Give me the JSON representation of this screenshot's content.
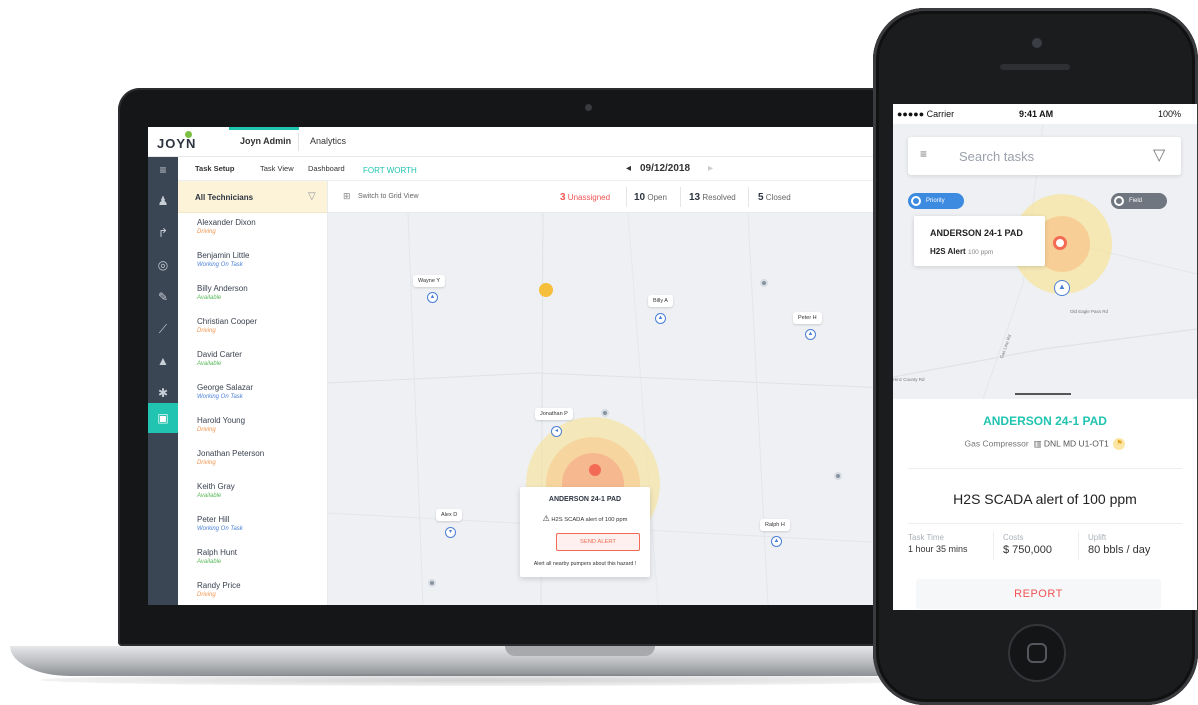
{
  "laptop": {
    "logo": "JOYN",
    "top_tabs": [
      {
        "label": "Joyn Admin",
        "active": true
      },
      {
        "label": "Analytics",
        "active": false
      }
    ],
    "sub_tabs": [
      {
        "label": "Task Setup",
        "active": true
      },
      {
        "label": "Task View",
        "active": false
      },
      {
        "label": "Dashboard",
        "active": false
      }
    ],
    "city": "FORT WORTH",
    "date": "09/12/2018",
    "panel": {
      "title": "All Technicians",
      "technicians": [
        {
          "name": "Alexander Dixon",
          "status": "Driving"
        },
        {
          "name": "Benjamin Little",
          "status": "Working On Task"
        },
        {
          "name": "Billy Anderson",
          "status": "Available"
        },
        {
          "name": "Christian Cooper",
          "status": "Driving"
        },
        {
          "name": "David Carter",
          "status": "Available"
        },
        {
          "name": "George Salazar",
          "status": "Working On Task"
        },
        {
          "name": "Harold Young",
          "status": "Driving"
        },
        {
          "name": "Jonathan Peterson",
          "status": "Driving"
        },
        {
          "name": "Keith Gray",
          "status": "Available"
        },
        {
          "name": "Peter Hill",
          "status": "Working On Task"
        },
        {
          "name": "Ralph Hunt",
          "status": "Available"
        },
        {
          "name": "Randy Price",
          "status": "Driving"
        }
      ]
    },
    "status_colors": {
      "Driving": "#f0944d",
      "Working On Task": "#4b7fd6",
      "Available": "#5cb85c"
    },
    "toolbar": {
      "grid_toggle": "Switch to Grid View",
      "stats": [
        {
          "count": "3",
          "label": "Unassigned",
          "color": "#f05454"
        },
        {
          "count": "10",
          "label": "Open",
          "color": "#2c3440"
        },
        {
          "count": "13",
          "label": "Resolved",
          "color": "#2c3440"
        },
        {
          "count": "5",
          "label": "Closed",
          "color": "#2c3440"
        }
      ]
    },
    "map_pins": [
      {
        "label": "Wayne Y"
      },
      {
        "label": "Billy A"
      },
      {
        "label": "Peter H"
      },
      {
        "label": "Jonathan P"
      },
      {
        "label": "Alex D"
      },
      {
        "label": "Ralph H"
      }
    ],
    "popup": {
      "title": "ANDERSON 24-1 PAD",
      "alert": "H2S SCADA alert of 100 ppm",
      "button": "SEND ALERT",
      "note": "Alert all nearby pumpers  about this hazard !"
    },
    "accent": "#21c4b0",
    "alert_color": "#f36b55"
  },
  "phone": {
    "status_bar": {
      "carrier": "●●●●● Carrier",
      "time": "9:41 AM",
      "battery": "100%"
    },
    "search": {
      "placeholder": "Search tasks"
    },
    "toggles": [
      {
        "label": "Priority",
        "on": true
      },
      {
        "label": "Field",
        "on": false
      }
    ],
    "map_card": {
      "title": "ANDERSON 24-1 PAD",
      "alert": "H2S Alert",
      "level": "100 ppm"
    },
    "road_labels": [
      "Old Eagle Pass Rd",
      "Gas Line Rd",
      "Hinz County Rd"
    ],
    "sheet": {
      "title": "ANDERSON 24-1 PAD",
      "equipment": "Gas Compressor",
      "asset_id": "DNL MD U1-OT1",
      "alert": "H2S SCADA alert of 100 ppm",
      "metrics": [
        {
          "label": "Task Time",
          "value": "1 hour 35 mins"
        },
        {
          "label": "Costs",
          "value": "$ 750,000"
        },
        {
          "label": "Uplift",
          "value": "80 bbls / day"
        }
      ],
      "report_button": "REPORT"
    }
  }
}
